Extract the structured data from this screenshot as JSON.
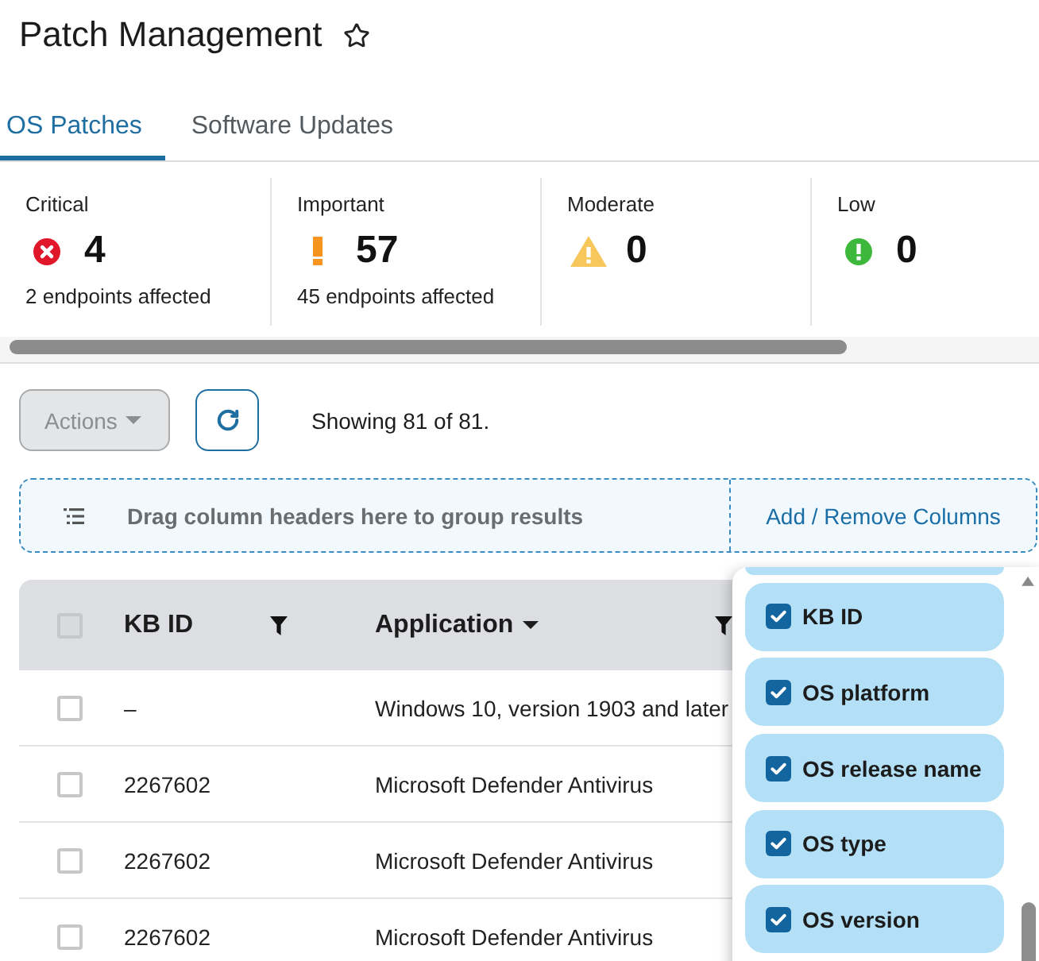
{
  "page": {
    "title": "Patch Management",
    "starred": false
  },
  "tabs": [
    {
      "label": "OS Patches",
      "selected": true
    },
    {
      "label": "Software Updates",
      "selected": false
    }
  ],
  "severity_cards": [
    {
      "kind": "critical",
      "label": "Critical",
      "count": "4",
      "detail": "2 endpoints affected"
    },
    {
      "kind": "important",
      "label": "Important",
      "count": "57",
      "detail": "45 endpoints affected"
    },
    {
      "kind": "moderate",
      "label": "Moderate",
      "count": "0"
    },
    {
      "kind": "low",
      "label": "Low",
      "count": "0"
    }
  ],
  "toolbar": {
    "actions": {
      "label": "Actions",
      "disabled": true
    },
    "result_count": "Showing 81 of 81."
  },
  "group_bar": {
    "hint": "Drag column headers here to group results",
    "columns_link": "Add / Remove Columns"
  },
  "table": {
    "select_all": {
      "checked": false
    },
    "columns": [
      {
        "label": "KB ID",
        "sorted": false
      },
      {
        "label": "Application",
        "sorted": true
      }
    ],
    "rows": [
      {
        "selected": false,
        "cells": [
          "–",
          "Windows 10, version 1903 and later"
        ]
      },
      {
        "selected": false,
        "cells": [
          "2267602",
          "Microsoft Defender Antivirus"
        ]
      },
      {
        "selected": false,
        "cells": [
          "2267602",
          "Microsoft Defender Antivirus"
        ]
      },
      {
        "selected": false,
        "cells": [
          "2267602",
          "Microsoft Defender Antivirus"
        ]
      }
    ]
  },
  "column_menu": {
    "options": [
      {
        "label": "KB ID",
        "checked": true
      },
      {
        "label": "OS platform",
        "checked": true
      },
      {
        "label": "OS release name",
        "checked": true
      },
      {
        "label": "OS type",
        "checked": true
      },
      {
        "label": "OS version",
        "checked": true
      }
    ]
  }
}
